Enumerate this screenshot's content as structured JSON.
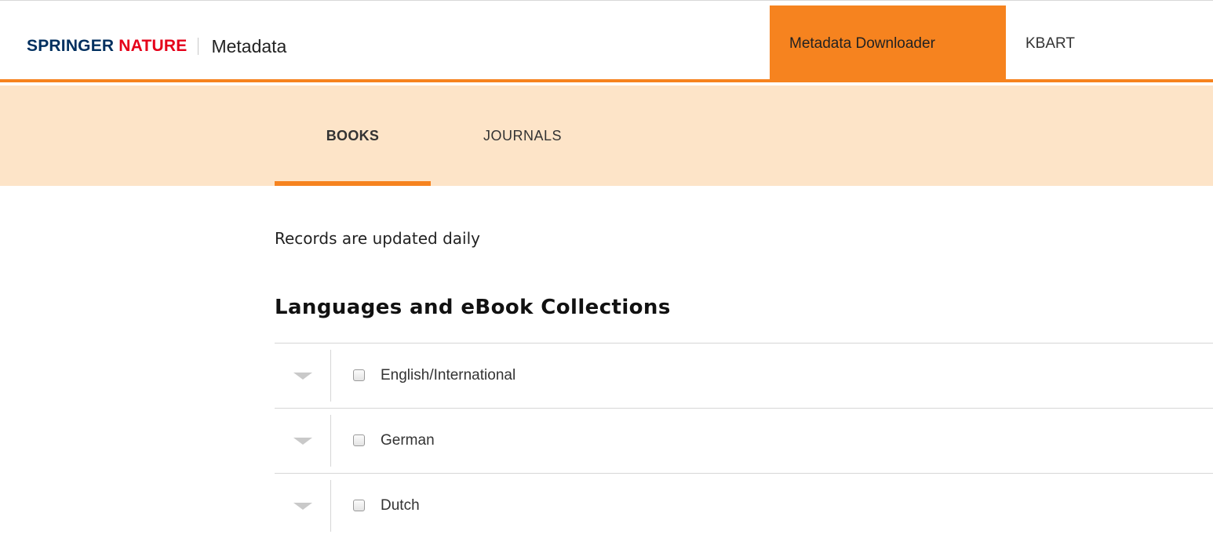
{
  "header": {
    "brand_part1": "SPRINGER",
    "brand_part2": "NATURE",
    "section": "Metadata",
    "nav": [
      {
        "label": "Metadata Downloader",
        "active": true
      },
      {
        "label": "KBART",
        "active": false
      }
    ]
  },
  "subnav": {
    "tabs": [
      {
        "label": "BOOKS",
        "active": true
      },
      {
        "label": "JOURNALS",
        "active": false
      }
    ]
  },
  "content": {
    "note": "Records are updated daily",
    "section_title": "Languages and eBook Collections",
    "collections": [
      {
        "label": "English/International",
        "checked": false,
        "icon": "chevron-down-icon"
      },
      {
        "label": "German",
        "checked": false,
        "icon": "chevron-down-icon"
      },
      {
        "label": "Dutch",
        "checked": false,
        "icon": "chevron-down-icon"
      }
    ]
  },
  "colors": {
    "accent": "#f6831f",
    "band": "#fde4c8",
    "brand_blue": "#002f5f",
    "brand_red": "#e50019"
  }
}
